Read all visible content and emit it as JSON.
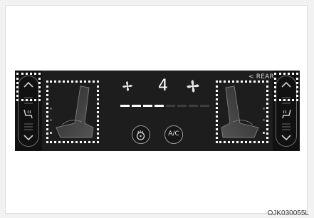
{
  "panel": {
    "fan_speed": "4",
    "rear_label": "< REAR",
    "ac_label": "A/C",
    "fan_level": 4,
    "fan_level_max": 8
  },
  "icons": {
    "fan_small": "fan-icon",
    "fan_large": "fan-icon",
    "steering_wheel_heat": "steering-wheel-heat-icon",
    "seat_heat_left": "seat-heat-icon",
    "seat_heat_right": "seat-heat-icon"
  },
  "colors": {
    "panel_bg": "#1d1d1d",
    "highlight": "#ffffff"
  },
  "figure_code": "OJK030055L"
}
